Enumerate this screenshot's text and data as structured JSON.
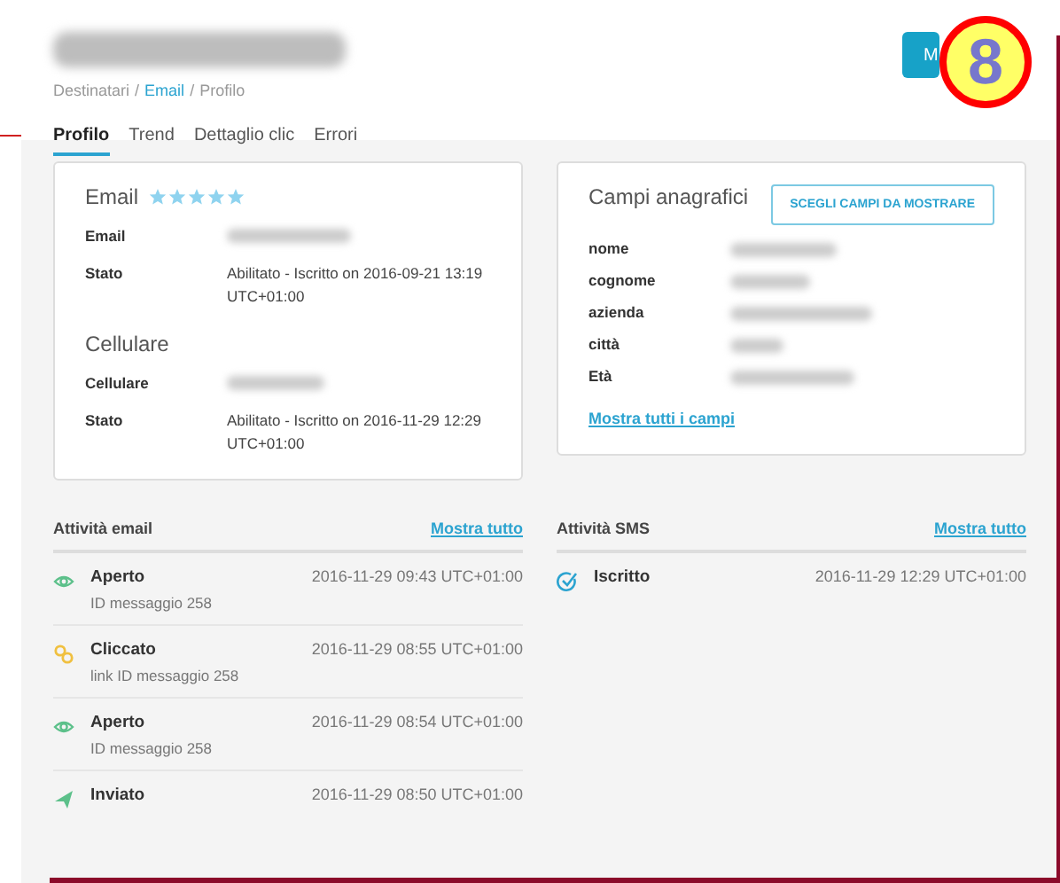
{
  "header": {
    "breadcrumb": [
      {
        "label": "Destinatari",
        "link": false
      },
      {
        "label": "Email",
        "link": true
      },
      {
        "label": "Profilo",
        "link": false
      }
    ],
    "separator": "/",
    "button": {
      "label": "M"
    },
    "badge": "8"
  },
  "tabs": [
    {
      "label": "Profilo",
      "selected": true
    },
    {
      "label": "Trend",
      "selected": false
    },
    {
      "label": "Dettaglio clic",
      "selected": false
    },
    {
      "label": "Errori",
      "selected": false
    }
  ],
  "contact_card": {
    "sections": [
      {
        "title": "Email",
        "stars": 5,
        "rows": [
          {
            "label": "Email"
          },
          {
            "label": "Stato",
            "value": "Abilitato - Iscritto on 2016-09-21 13:19 UTC+01:00"
          }
        ]
      },
      {
        "title": "Cellulare",
        "rows": [
          {
            "label": "Cellulare"
          },
          {
            "label": "Stato",
            "value": "Abilitato - Iscritto on 2016-11-29 12:29 UTC+01:00"
          }
        ]
      }
    ]
  },
  "fields_card": {
    "title": "Campi anagrafici",
    "button": "SCEGLI CAMPI DA MOSTRARE",
    "fields": [
      {
        "label": "nome"
      },
      {
        "label": "cognome"
      },
      {
        "label": "azienda"
      },
      {
        "label": "città"
      },
      {
        "label": "Età"
      }
    ],
    "link": "Mostra tutti i campi"
  },
  "activities": [
    {
      "title": "Attività email",
      "link": "Mostra tutto",
      "items": [
        {
          "kind": "opened",
          "title": "Aperto",
          "subtitle": "ID messaggio 258",
          "time": "2016-11-29 09:43 UTC+01:00"
        },
        {
          "kind": "clicked",
          "title": "Cliccato",
          "subtitle": "link ID messaggio 258",
          "time": "2016-11-29 08:55 UTC+01:00"
        },
        {
          "kind": "opened",
          "title": "Aperto",
          "subtitle": "ID messaggio 258",
          "time": "2016-11-29 08:54 UTC+01:00"
        },
        {
          "kind": "sent",
          "title": "Inviato",
          "time": "2016-11-29 08:50 UTC+01:00"
        }
      ]
    },
    {
      "title": "Attività SMS",
      "link": "Mostra tutto",
      "items": [
        {
          "kind": "subscribed",
          "title": "Iscritto",
          "time": "2016-11-29 12:29 UTC+01:00"
        }
      ]
    }
  ]
}
